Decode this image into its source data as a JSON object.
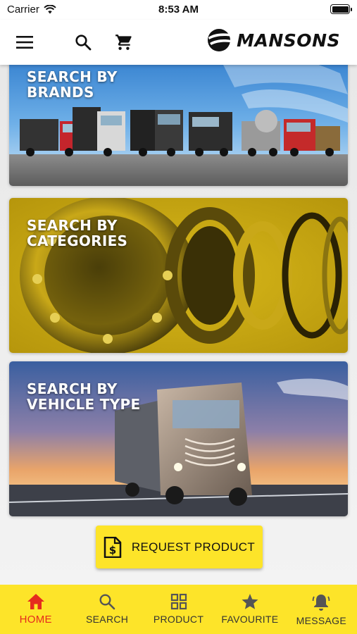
{
  "status_bar": {
    "carrier": "Carrier",
    "time": "8:53 AM"
  },
  "header": {
    "brand": "MANSONS",
    "icons": [
      "menu-icon",
      "search-icon",
      "cart-icon"
    ]
  },
  "cards": [
    {
      "id": "brands",
      "title_line1": "SEARCH BY",
      "title_line2": "BRANDS"
    },
    {
      "id": "categories",
      "title_line1": "SEARCH BY",
      "title_line2": "CATEGORIES"
    },
    {
      "id": "vehicle",
      "title_line1": "SEARCH BY",
      "title_line2": "VEHICLE TYPE"
    }
  ],
  "request_button": {
    "label": "REQUEST PRODUCT",
    "icon": "dollar-document-icon"
  },
  "bottom_nav": [
    {
      "label": "HOME",
      "icon": "home-icon",
      "active": true
    },
    {
      "label": "SEARCH",
      "icon": "search-icon",
      "active": false
    },
    {
      "label": "PRODUCT",
      "icon": "grid-icon",
      "active": false
    },
    {
      "label": "FAVOURITE",
      "icon": "star-icon",
      "active": false
    },
    {
      "label": "MESSAGE",
      "icon": "bell-icon",
      "active": false
    }
  ],
  "colors": {
    "accent_yellow": "#fde429",
    "active_red": "#e52b1e",
    "header_bg": "#ffffff"
  }
}
